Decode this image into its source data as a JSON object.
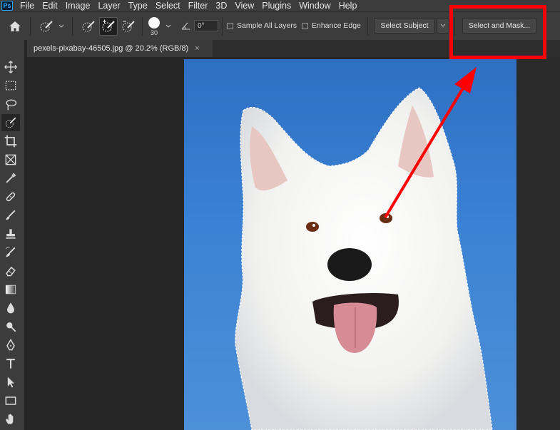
{
  "app": {
    "logo_text": "Ps"
  },
  "menu": [
    "File",
    "Edit",
    "Image",
    "Layer",
    "Type",
    "Select",
    "Filter",
    "3D",
    "View",
    "Plugins",
    "Window",
    "Help"
  ],
  "options": {
    "brush_size": "30",
    "angle": "0°",
    "sample_all_layers": {
      "label": "Sample All Layers",
      "checked": false
    },
    "enhance_edge": {
      "label": "Enhance Edge",
      "checked": false
    },
    "select_subject_label": "Select Subject",
    "select_and_mask_label": "Select and Mask..."
  },
  "document": {
    "tab_title": "pexels-pixabay-46505.jpg @ 20.2% (RGB/8)",
    "close_glyph": "×"
  },
  "toolbar": {
    "tools": [
      {
        "name": "move-tool-icon"
      },
      {
        "name": "rectangular-marquee-icon"
      },
      {
        "name": "lasso-icon"
      },
      {
        "name": "quick-selection-icon",
        "active": true
      },
      {
        "name": "crop-icon"
      },
      {
        "name": "frame-icon"
      },
      {
        "name": "eyedropper-icon"
      },
      {
        "name": "healing-brush-icon"
      },
      {
        "name": "brush-icon"
      },
      {
        "name": "clone-stamp-icon"
      },
      {
        "name": "history-brush-icon"
      },
      {
        "name": "eraser-icon"
      },
      {
        "name": "gradient-icon"
      },
      {
        "name": "blur-icon"
      },
      {
        "name": "dodge-icon"
      },
      {
        "name": "pen-icon"
      },
      {
        "name": "type-icon"
      },
      {
        "name": "path-selection-icon"
      },
      {
        "name": "rectangle-shape-icon"
      },
      {
        "name": "hand-icon"
      }
    ]
  },
  "colors": {
    "accent": "#31a8ff",
    "annotation": "#ff0000",
    "ui_bg": "#3c3c3c",
    "canvas_bg": "#262626"
  }
}
